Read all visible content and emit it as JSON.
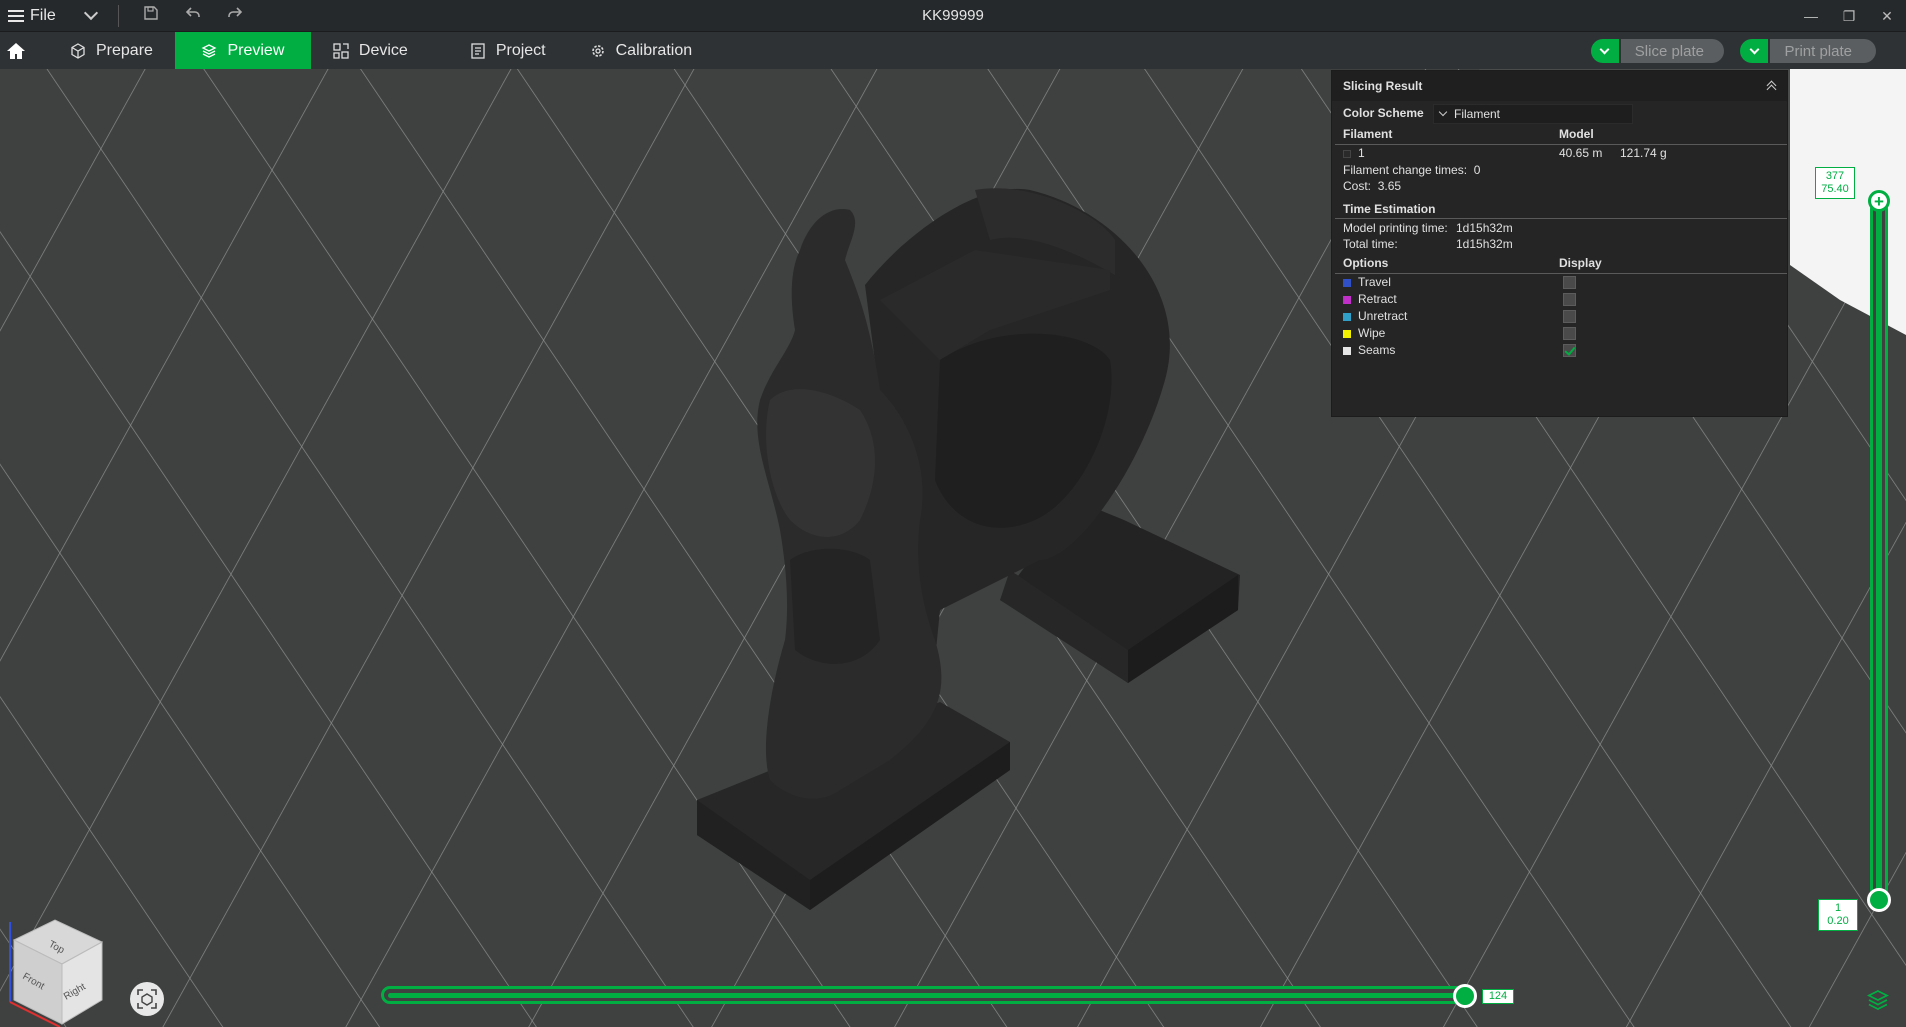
{
  "titlebar": {
    "file_label": "File",
    "window_title": "KK99999"
  },
  "tabs": {
    "prepare": "Prepare",
    "preview": "Preview",
    "device": "Device",
    "project": "Project",
    "calibration": "Calibration"
  },
  "actions": {
    "slice_plate": "Slice plate",
    "print_plate": "Print plate"
  },
  "slicing_result": {
    "title": "Slicing Result",
    "color_scheme_label": "Color Scheme",
    "color_scheme_value": "Filament",
    "filament_header": "Filament",
    "model_header": "Model",
    "filament_id": "1",
    "filament_length": "40.65 m",
    "filament_weight": "121.74 g",
    "filament_change_label": "Filament change times:",
    "filament_change_value": "0",
    "cost_label": "Cost:",
    "cost_value": "3.65",
    "time_estimation_header": "Time Estimation",
    "model_print_time_label": "Model printing time:",
    "model_print_time_value": "1d15h32m",
    "total_time_label": "Total time:",
    "total_time_value": "1d15h32m",
    "options_header": "Options",
    "display_header": "Display",
    "options": [
      {
        "label": "Travel",
        "color": "#3050c8",
        "checked": false
      },
      {
        "label": "Retract",
        "color": "#c030c8",
        "checked": false
      },
      {
        "label": "Unretract",
        "color": "#30a0c8",
        "checked": false
      },
      {
        "label": "Wipe",
        "color": "#f0f000",
        "checked": false
      },
      {
        "label": "Seams",
        "color": "#e6e6e6",
        "checked": true
      }
    ]
  },
  "layer_slider": {
    "top_layer": "377",
    "top_height": "75.40",
    "bottom_layer": "1",
    "bottom_height": "0.20"
  },
  "move_slider": {
    "value": "124"
  },
  "view_cube": {
    "top": "Top",
    "front": "Front",
    "right": "Right"
  },
  "colors": {
    "accent": "#00ae42",
    "background": "#3f4040",
    "panel": "#252525",
    "model": "#262626"
  }
}
